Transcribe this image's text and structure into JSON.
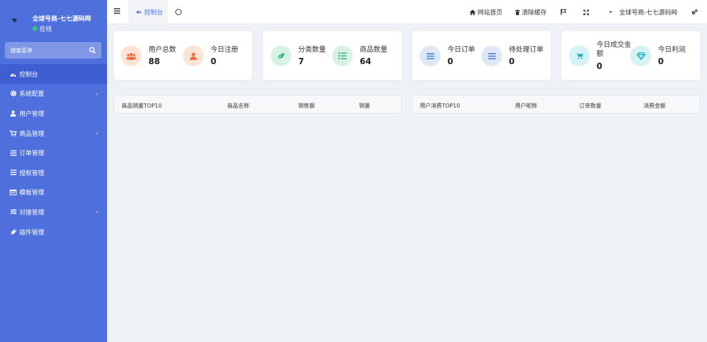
{
  "sidebar": {
    "user_name": "全球号商-七七源码网",
    "status": "在线",
    "search_placeholder": "搜索菜单",
    "items": [
      {
        "label": "控制台",
        "icon": "dashboard-icon",
        "active": true,
        "has_arrow": false
      },
      {
        "label": "系统配置",
        "icon": "gear-icon",
        "active": false,
        "has_arrow": true
      },
      {
        "label": "用户管理",
        "icon": "user-icon",
        "active": false,
        "has_arrow": false
      },
      {
        "label": "商品管理",
        "icon": "cart-icon",
        "active": false,
        "has_arrow": true
      },
      {
        "label": "订单管理",
        "icon": "list-icon",
        "active": false,
        "has_arrow": false
      },
      {
        "label": "授权管理",
        "icon": "list-icon",
        "active": false,
        "has_arrow": false
      },
      {
        "label": "模板管理",
        "icon": "template-icon",
        "active": false,
        "has_arrow": false
      },
      {
        "label": "对接管理",
        "icon": "sliders-icon",
        "active": false,
        "has_arrow": true
      },
      {
        "label": "插件管理",
        "icon": "plugin-icon",
        "active": false,
        "has_arrow": false
      }
    ]
  },
  "topbar": {
    "tab_label": "控制台",
    "nav": {
      "home": "网站首页",
      "clear_cache": "清除缓存",
      "account": "全球号商-七七源码网"
    }
  },
  "stats": {
    "users_total_label": "用户总数",
    "users_total_value": "88",
    "today_register_label": "今日注册",
    "today_register_value": "0",
    "category_count_label": "分类数量",
    "category_count_value": "7",
    "product_count_label": "商品数量",
    "product_count_value": "64",
    "today_orders_label": "今日订单",
    "today_orders_value": "0",
    "pending_orders_label": "待处理订单",
    "pending_orders_value": "0",
    "today_deal_label_1": "今日成交金",
    "today_deal_label_2": "额",
    "today_deal_value": "0",
    "today_profit_label": "今日利润",
    "today_profit_value": "0"
  },
  "tables": {
    "products": {
      "title": "商品销量TOP10",
      "headers": [
        "商品名称",
        "销售额",
        "销量"
      ]
    },
    "users": {
      "title": "用户消费TOP10",
      "headers": [
        "用户昵称",
        "订单数量",
        "消费金额"
      ]
    }
  },
  "colors": {
    "sidebar": "#4f6fdc",
    "accent": "#4f6fdc",
    "orange": "#f26b3a",
    "green": "#2fb36b",
    "blue": "#4a7fd6",
    "teal": "#19aebf"
  }
}
